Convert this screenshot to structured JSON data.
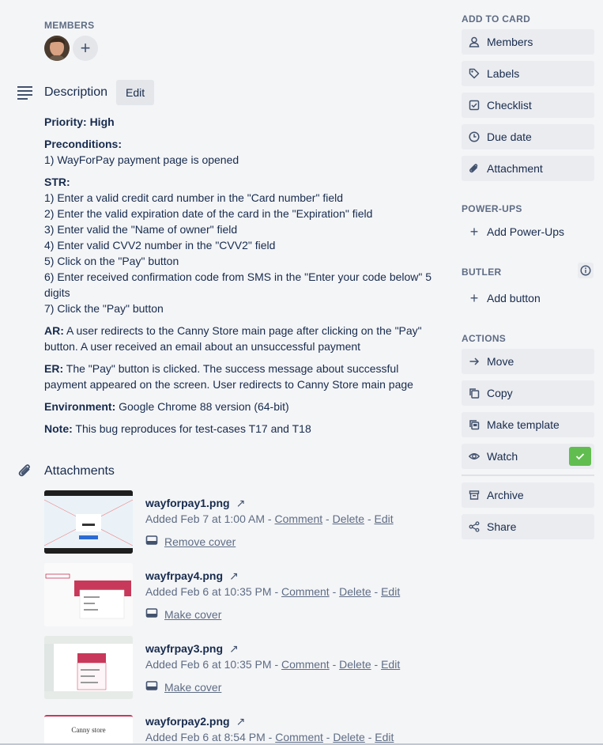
{
  "members": {
    "label": "MEMBERS",
    "add_symbol": "+"
  },
  "description": {
    "title": "Description",
    "edit_label": "Edit",
    "priority": {
      "key": "Priority: High"
    },
    "preconditions": {
      "key": "Preconditions:",
      "lines": [
        "1) WayForPay payment page is opened"
      ]
    },
    "str": {
      "key": "STR:",
      "lines": [
        "1) Enter a valid credit card number in the \"Card number\" field",
        "2) Enter the valid expiration date of the card in the \"Expiration\" field",
        "3) Enter valid the \"Name of owner\" field",
        "4) Enter valid CVV2 number in the \"CVV2\" field",
        "5) Click on the \"Pay\" button",
        "6) Enter received confirmation code from SMS in the \"Enter your code below\" 5 digits",
        "7) Click the \"Pay\" button"
      ]
    },
    "ar": {
      "key": "AR:",
      "text": " A user redirects to the Canny Store main page after clicking on the \"Pay\" button. A user received an email about an unsuccessful payment"
    },
    "er": {
      "key": "ER:",
      "text": " The \"Pay\" button is clicked. The success message about successful payment appeared on the screen. User redirects to Canny Store main page"
    },
    "environment": {
      "key": "Environment:",
      "text": " Google Chrome 88 version (64-bit)"
    },
    "note": {
      "key": "Note:",
      "text": " This bug reproduces for test-cases T17 and T18"
    }
  },
  "attachments": {
    "title": "Attachments",
    "items": [
      {
        "name": "wayforpay1.png",
        "added": "Added Feb 7 at 1:00 AM",
        "comment": "Comment",
        "delete": "Delete",
        "edit": "Edit",
        "cover": "Remove cover",
        "sep": " - "
      },
      {
        "name": "wayfrpay4.png",
        "added": "Added Feb 6 at 10:35 PM",
        "comment": "Comment",
        "delete": "Delete",
        "edit": "Edit",
        "cover": "Make cover",
        "sep": " - "
      },
      {
        "name": "wayfrpay3.png",
        "added": "Added Feb 6 at 10:35 PM",
        "comment": "Comment",
        "delete": "Delete",
        "edit": "Edit",
        "cover": "Make cover",
        "sep": " - "
      },
      {
        "name": "wayforpay2.png",
        "added": "Added Feb 6 at 8:54 PM",
        "comment": "Comment",
        "delete": "Delete",
        "edit": "Edit",
        "sep": " - "
      }
    ],
    "thumb_text": "Canny store"
  },
  "sidebar": {
    "add_to_card": {
      "label": "ADD TO CARD",
      "items": [
        "Members",
        "Labels",
        "Checklist",
        "Due date",
        "Attachment"
      ]
    },
    "power_ups": {
      "label": "POWER-UPS",
      "add": "Add Power-Ups"
    },
    "butler": {
      "label": "BUTLER",
      "add": "Add button"
    },
    "actions": {
      "label": "ACTIONS",
      "items": [
        "Move",
        "Copy",
        "Make template",
        "Watch",
        "Archive",
        "Share"
      ]
    }
  },
  "colors": {
    "watch_check": "#61bd4f",
    "thumb_red": "#c8385a",
    "text": "#172b4d",
    "muted": "#5e6c84"
  }
}
